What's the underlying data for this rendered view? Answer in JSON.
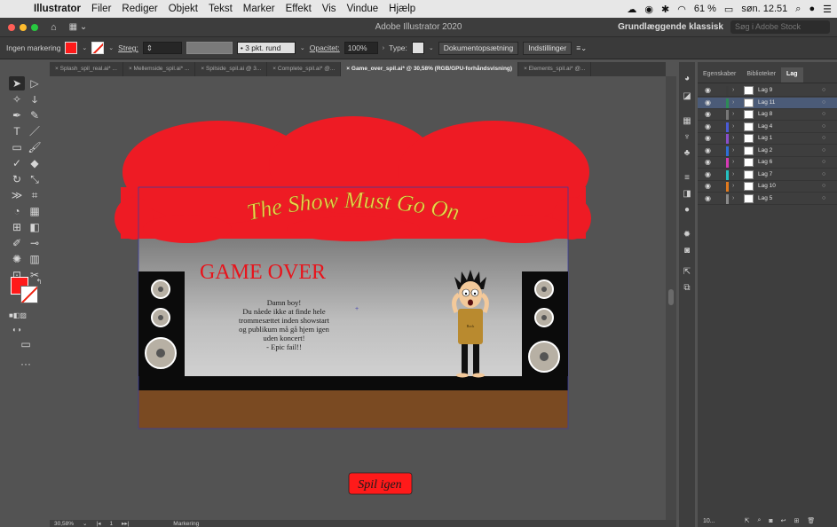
{
  "menubar": {
    "apple": "",
    "app_name": "Illustrator",
    "items": [
      "Filer",
      "Rediger",
      "Objekt",
      "Tekst",
      "Marker",
      "Effekt",
      "Vis",
      "Vindue",
      "Hjælp"
    ],
    "battery": "61 %",
    "clock": "søn. 12.51"
  },
  "titlebar": {
    "title": "Adobe Illustrator 2020",
    "workspace": "Grundlæggende klassisk",
    "search_placeholder": "Søg i Adobe Stock"
  },
  "controlbar": {
    "selection_status": "Ingen markering",
    "stroke_label": "Streg:",
    "brush": "3 pkt. rund",
    "opacity_label": "Opacitet:",
    "opacity_value": "100%",
    "type_label": "Type:",
    "doc_setup_button": "Dokumentopsætning",
    "preferences_button": "Indstillinger"
  },
  "doc_tabs": [
    "Splash_spil_real.ai* ...",
    "Mellemside_spil.ai* ...",
    "Spilside_spil.ai @ 3...",
    "Complete_spil.ai* @...",
    "Game_over_spil.ai* @ 30,58% (RGB/GPU-forhåndsvisning)",
    "Elements_spil.ai* @..."
  ],
  "artwork": {
    "curtain_title": "The Show Must Go On",
    "game_over": "GAME OVER",
    "message_lines": [
      "Damn boy!",
      "Du nåede ikke at finde hele",
      "trommesættet inden showstart",
      "og publikum må gå hjem igen",
      "uden koncert!",
      "- Epic fail!!"
    ],
    "shirt_text": "Rock",
    "retry_button": "Spil igen"
  },
  "statusbar": {
    "zoom": "30,58%",
    "artboard": "1",
    "tool": "Markering"
  },
  "layers_panel": {
    "tabs": [
      "Egenskaber",
      "Biblioteker",
      "Lag"
    ],
    "layers": [
      {
        "name": "Lag 9",
        "color": "#3c3c3c"
      },
      {
        "name": "Lag 11",
        "color": "#2e8b57"
      },
      {
        "name": "Lag 8",
        "color": "#777777"
      },
      {
        "name": "Lag 4",
        "color": "#4a5bd6"
      },
      {
        "name": "Lag 1",
        "color": "#8a4ec9"
      },
      {
        "name": "Lag 2",
        "color": "#2e6fd6"
      },
      {
        "name": "Lag 6",
        "color": "#d63ab4"
      },
      {
        "name": "Lag 7",
        "color": "#25c0c0"
      },
      {
        "name": "Lag 10",
        "color": "#e07a1e"
      },
      {
        "name": "Lag 5",
        "color": "#8a8a8a"
      }
    ],
    "selected_index": 1,
    "count_label": "10..."
  }
}
